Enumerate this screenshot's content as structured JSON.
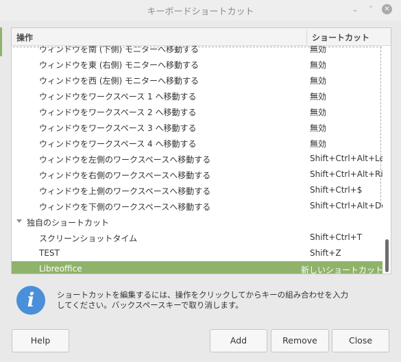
{
  "window": {
    "title": "キーボードショートカット",
    "minimize": "⌄",
    "maximize": "˄",
    "close": "✕"
  },
  "table": {
    "headers": {
      "action": "操作",
      "shortcut": "ショートカット"
    },
    "rows": [
      {
        "action": "ウィンドウを南 (下側) モニターへ移動する",
        "shortcut": "無効"
      },
      {
        "action": "ウィンドウを東 (右側) モニターへ移動する",
        "shortcut": "無効"
      },
      {
        "action": "ウィンドウを西 (左側) モニターへ移動する",
        "shortcut": "無効"
      },
      {
        "action": "ウィンドウをワークスペース 1 へ移動する",
        "shortcut": "無効"
      },
      {
        "action": "ウィンドウをワークスペース 2 へ移動する",
        "shortcut": "無効"
      },
      {
        "action": "ウィンドウをワークスペース 3 へ移動する",
        "shortcut": "無効"
      },
      {
        "action": "ウィンドウをワークスペース 4 へ移動する",
        "shortcut": "無効"
      },
      {
        "action": "ウィンドウを左側のワークスペースへ移動する",
        "shortcut": "Shift+Ctrl+Alt+Left"
      },
      {
        "action": "ウィンドウを右側のワークスペースへ移動する",
        "shortcut": "Shift+Ctrl+Alt+Right"
      },
      {
        "action": "ウィンドウを上側のワークスペースへ移動する",
        "shortcut": "Shift+Ctrl+$"
      },
      {
        "action": "ウィンドウを下側のワークスペースへ移動する",
        "shortcut": "Shift+Ctrl+Alt+Down"
      }
    ],
    "group": {
      "label": "独自のショートカット"
    },
    "custom_rows": [
      {
        "action": "スクリーンショットタイム",
        "shortcut": "Shift+Ctrl+T"
      },
      {
        "action": "TEST",
        "shortcut": "Shift+Z"
      },
      {
        "action": "Libreoffice",
        "shortcut": "新しいショートカット...",
        "selected": true
      }
    ]
  },
  "info": {
    "icon": "info-icon",
    "text": "ショートカットを編集するには、操作をクリックしてからキーの組み合わせを入力してください。バックスペースキーで取り消します。"
  },
  "buttons": {
    "help": "Help",
    "add": "Add",
    "remove": "Remove",
    "close": "Close"
  },
  "colors": {
    "selection": "#8fb36a",
    "info_icon": "#4a8fd9"
  }
}
